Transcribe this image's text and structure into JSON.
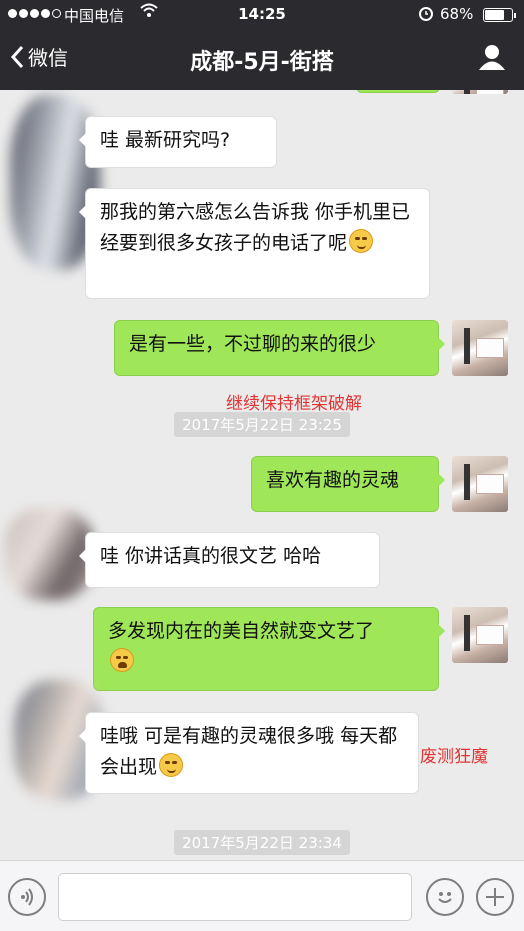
{
  "status_bar": {
    "carrier": "中国电信",
    "time": "14:25",
    "battery_percent": "68%",
    "battery_level": 0.68
  },
  "nav": {
    "back_label": "微信",
    "title": "成都-5月-街搭"
  },
  "messages": [
    {
      "side": "in",
      "text": "哇 最新研究吗?"
    },
    {
      "side": "in",
      "text": "那我的第六感怎么告诉我 你手机里已经要到很多女孩子的电话了呢",
      "emoji": "blush-emoji"
    },
    {
      "side": "out",
      "text": "是有一些，不过聊的来的很少"
    },
    {
      "side": "out",
      "text": "喜欢有趣的灵魂"
    },
    {
      "side": "in",
      "text": "哇 你讲话真的很文艺 哈哈"
    },
    {
      "side": "out",
      "text": "多发现内在的美自然就变文艺了",
      "emoji": "crying-laugh-emoji"
    },
    {
      "side": "in",
      "text": "哇哦 可是有趣的灵魂很多哦 每天都会出现",
      "emoji": "thinking-emoji"
    }
  ],
  "annotations": {
    "note_1": "继续保持框架破解",
    "note_2": "废测狂魔"
  },
  "timestamps": {
    "ts_1": "2017年5月22日 23:25",
    "ts_2": "2017年5月22日 23:34"
  },
  "colors": {
    "nav_bg": "#2b2b2f",
    "chat_bg": "#ebebeb",
    "outgoing_bubble": "#9fe658",
    "incoming_bubble": "#ffffff",
    "annotation_red": "#e33434"
  }
}
